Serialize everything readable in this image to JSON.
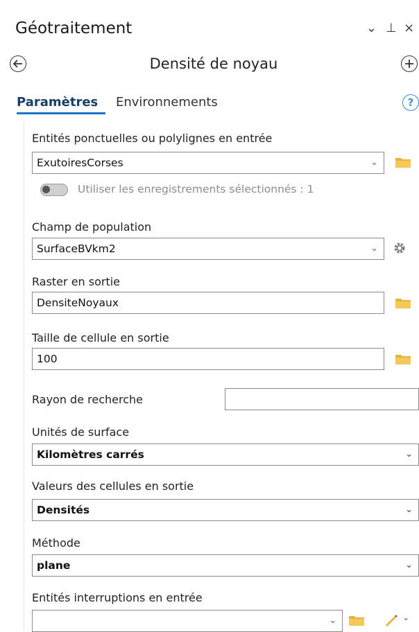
{
  "header": {
    "title": "Géotraitement",
    "controls": [
      "⌄",
      "⊥",
      "×"
    ]
  },
  "tool": {
    "back_icon": "arrow-left-circle-icon",
    "title": "Densité de noyau",
    "add_icon": "plus-circle-icon"
  },
  "tabs": [
    {
      "label": "Paramètres",
      "active": true
    },
    {
      "label": "Environnements",
      "active": false
    }
  ],
  "help_glyph": "?",
  "params": {
    "input_features": {
      "label": "Entités ponctuelles ou polylignes en entrée",
      "value": "ExutoiresCorses",
      "toggle_label": "Utiliser les enregistrements sélectionnés : 1"
    },
    "population_field": {
      "label": "Champ de population",
      "value": "SurfaceBVkm2"
    },
    "output_raster": {
      "label": "Raster en sortie",
      "value": "DensiteNoyaux"
    },
    "cell_size": {
      "label": "Taille de cellule en sortie",
      "value": "100"
    },
    "search_radius": {
      "label": "Rayon de recherche",
      "value": ""
    },
    "area_units": {
      "label": "Unités de surface",
      "value": "Kilomètres carrés"
    },
    "output_values": {
      "label": "Valeurs des cellules en sortie",
      "value": "Densités"
    },
    "method": {
      "label": "Méthode",
      "value": "plane"
    },
    "barriers": {
      "label": "Entités interruptions en entrée",
      "value": ""
    }
  },
  "colors": {
    "accent": "#1a73c7",
    "folder": "#e8b43a",
    "help": "#3d8fd6"
  }
}
